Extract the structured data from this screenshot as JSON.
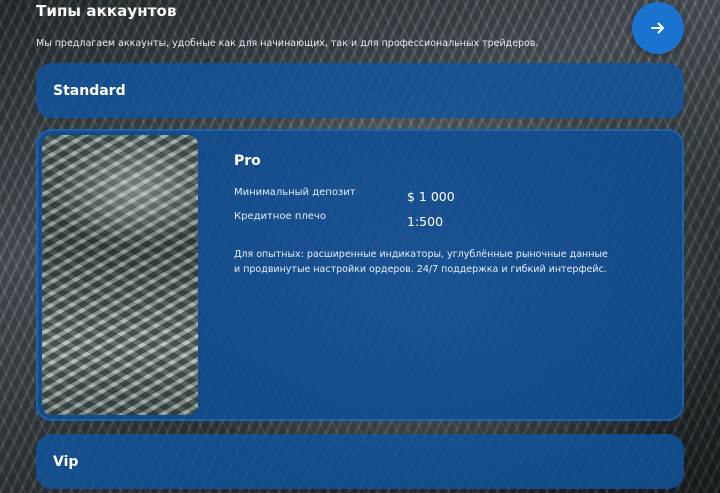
{
  "header": {
    "title": "Типы аккаунтов",
    "subtitle": "Мы предлагаем аккаунты, удобные как для начинающих, так и для профессиональных трейдеров.",
    "next_icon": "arrow-right-icon",
    "accent_color": "#1a74cf"
  },
  "accounts": [
    {
      "name": "Standard",
      "expanded": false
    },
    {
      "name": "Pro",
      "expanded": true,
      "image_icon": "money-swirl-image",
      "specs": [
        {
          "label": "Минимальный депозит",
          "value": "$ 1 000"
        },
        {
          "label": "Кредитное плечо",
          "value": "1:500"
        }
      ],
      "description": "Для опытных: расширенные индикаторы, углублённые рыночные данные и продвинутые настройки ордеров. 24/7 поддержка и гибкий интерфейс."
    },
    {
      "name": "Vip",
      "expanded": false
    }
  ]
}
